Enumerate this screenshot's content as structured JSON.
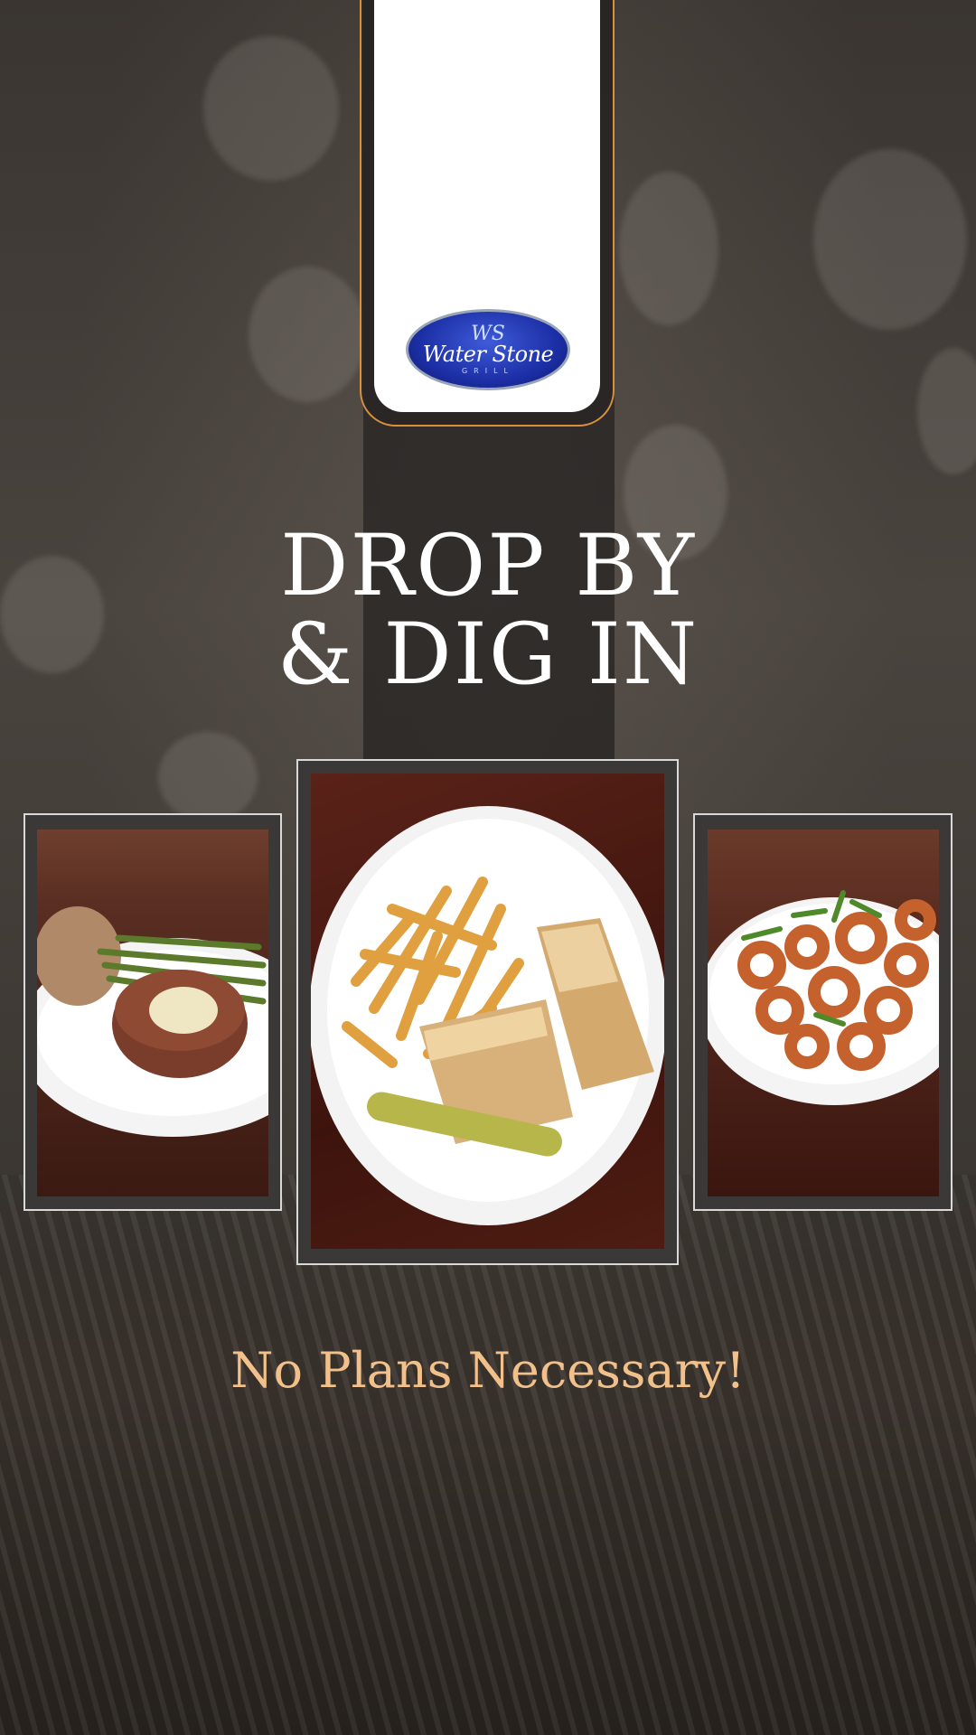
{
  "brand": {
    "logo_mark": "WS",
    "logo_name": "Water Stone",
    "logo_sub": "GRILL"
  },
  "headline": {
    "line1": "DROP BY",
    "line2": "& DIG IN"
  },
  "photos": {
    "left": "steak-with-potato-and-green-beans",
    "center": "sandwich-with-fries-and-pickle",
    "right": "fried-calamari-salad"
  },
  "tagline": "No Plans Necessary!",
  "colors": {
    "accent_orange": "#d98f3c",
    "tagline": "#f2c08a",
    "logo_blue": "#1c2fa6"
  }
}
